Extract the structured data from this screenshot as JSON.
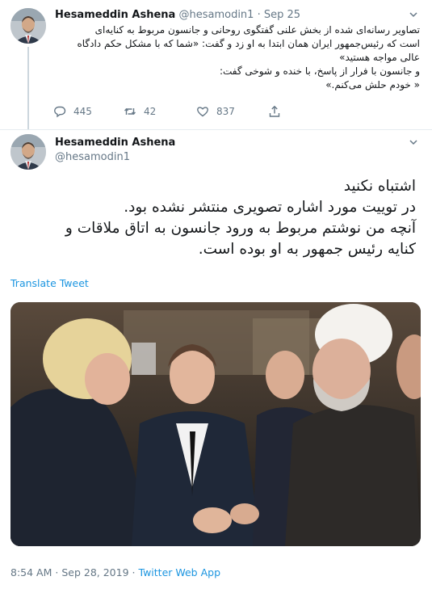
{
  "quoted_tweet": {
    "display_name": "Hesameddin Ashena",
    "handle": "@hesamodin1",
    "separator": "·",
    "date": "Sep 25",
    "text_lines": [
      "تصاویر رسانه‌ای شده از بخش علنی گفتگوی روحانی و جانسون مربوط به کنایه‌ای",
      "است که رئیس‌جمهور ایران همان ابتدا به او زد و گفت: «شما که با مشکل حکم دادگاه",
      "عالی مواجه هستید»",
      "و جانسون با فرار از پاسخ، با خنده و شوخی گفت:",
      "« خودم حلش می‌کنم.»"
    ],
    "reply_count": "445",
    "retweet_count": "42",
    "like_count": "837",
    "icons": [
      "reply-icon",
      "retweet-icon",
      "like-icon",
      "share-icon",
      "chevron-down-icon"
    ]
  },
  "main_tweet": {
    "display_name": "Hesameddin Ashena",
    "handle": "@hesamodin1",
    "text_lines": [
      "اشتباه نکنید",
      "در توییت مورد اشاره تصویری منتشر نشده بود.",
      "آنچه من نوشتم مربوط به ورود جانسون به اتاق ملاقات و",
      "کنایه رئیس جمهور به او بوده است."
    ],
    "translate_label": "Translate Tweet",
    "time": "8:54 AM",
    "separator": "·",
    "date": "Sep 28, 2019",
    "source": "Twitter Web App"
  },
  "colors": {
    "link": "#1b95e0",
    "secondary_text": "#657786",
    "primary_text": "#14171a",
    "thread_line": "#ccd6dd"
  }
}
